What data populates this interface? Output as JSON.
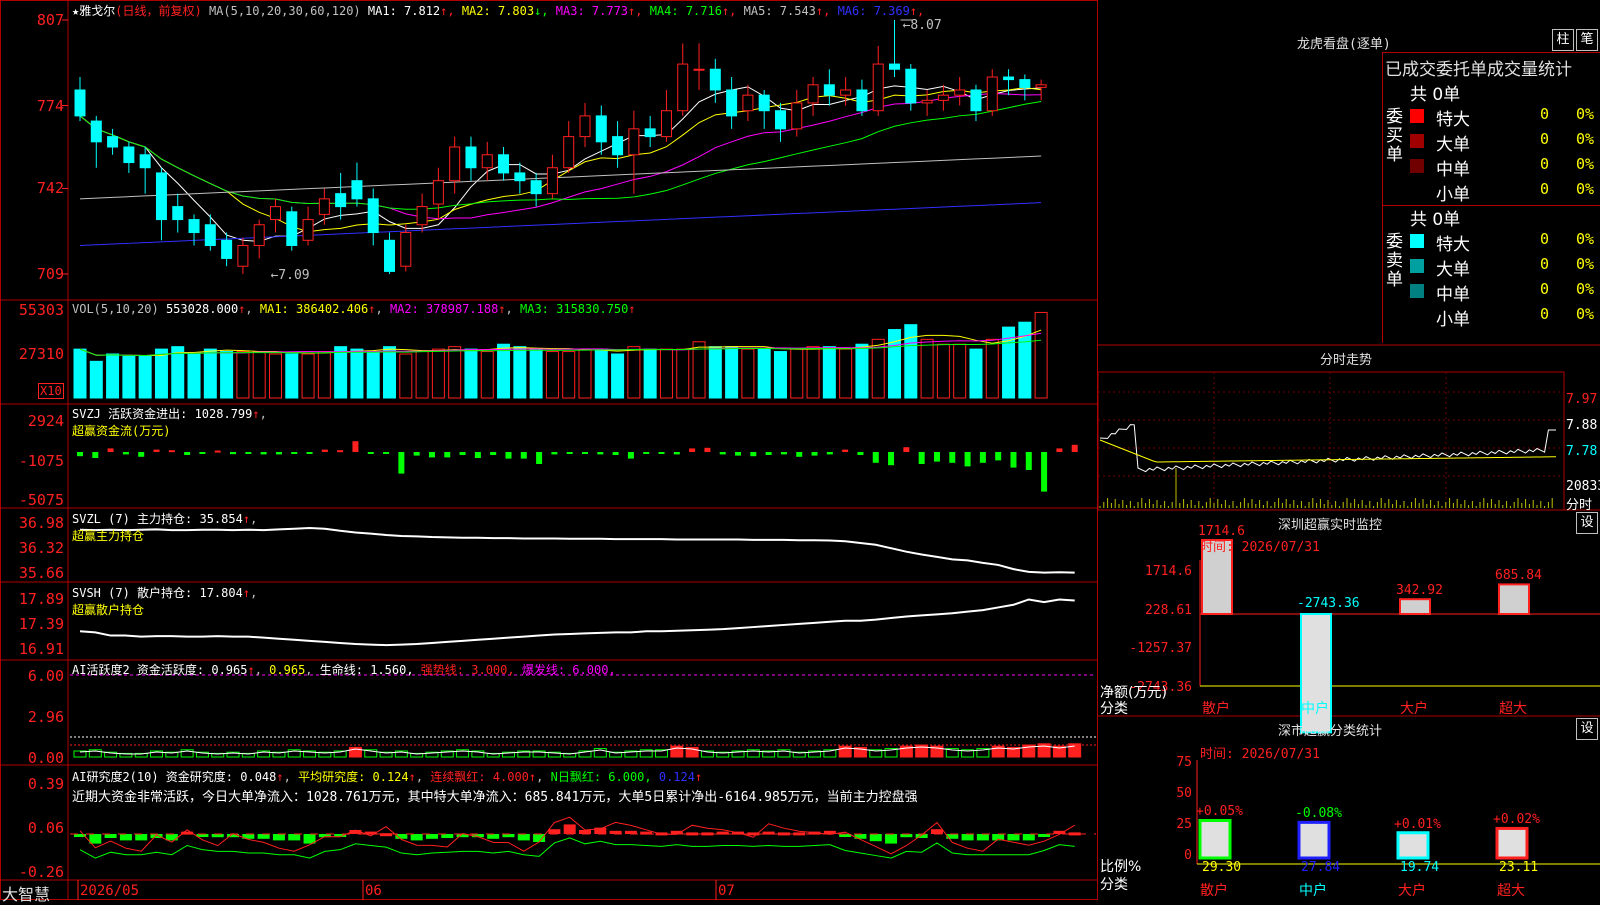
{
  "app": {
    "brand": "大智慧"
  },
  "main": {
    "stock_name": "雅戈尔",
    "period": "(日线，前复权)",
    "ma_label": "MA(5,10,20,30,60,120)",
    "ma_values": [
      {
        "label": "MA1: 7.812",
        "arrow": "↑",
        "color": "#ffffff"
      },
      {
        "label": "MA2: 7.803",
        "arrow": "↓",
        "color": "#ffff00"
      },
      {
        "label": "MA3: 7.773",
        "arrow": "↑",
        "color": "#ff00ff"
      },
      {
        "label": "MA4: 7.716",
        "arrow": "↑",
        "color": "#00ff00"
      },
      {
        "label": "MA5: 7.543",
        "arrow": "↑",
        "color": "#c0c0c0"
      },
      {
        "label": "MA6: 7.369",
        "arrow": "↑",
        "color": "#3030ff"
      }
    ],
    "y_ticks": [
      "807",
      "774",
      "742",
      "709"
    ],
    "high_label": "8.07",
    "low_label": "7.09",
    "dates": [
      "2026/05",
      "06",
      "07"
    ]
  },
  "volume": {
    "label": "VOL(5,10,20)",
    "current": "553028.000",
    "ma1": "MA1: 386402.406",
    "ma2": "MA2: 378987.188",
    "ma3": "MA3: 315830.750",
    "y_ticks": [
      "55303",
      "27310"
    ],
    "unit": "X10"
  },
  "svzj": {
    "label": "SVZJ  活跃资金进出: 1028.799",
    "sub": "超赢资金流(万元)",
    "y_ticks": [
      "2924",
      "-1075",
      "-5075"
    ]
  },
  "svzl": {
    "label": "SVZL (7) 主力持仓: 35.854",
    "sub": "超赢主力持仓",
    "y_ticks": [
      "36.98",
      "36.32",
      "35.66"
    ]
  },
  "svsh": {
    "label": "SVSH (7) 散户持仓: 17.804",
    "sub": "超赢散户持仓",
    "y_ticks": [
      "17.89",
      "17.39",
      "16.91"
    ]
  },
  "ai1": {
    "label": "AI活跃度2 资金活跃度: 0.965",
    "v2": "0.965",
    "life": "生命线: 1.560,",
    "strong": "强势线: 3.000,",
    "burst": "爆发线: 6.000,",
    "y_ticks": [
      "6.00",
      "2.96",
      "0.00"
    ]
  },
  "ai2": {
    "label": "AI研究度2(10) 资金研究度: 0.048",
    "avg": "平均研究度: 0.124",
    "red": "连续飘红: 4.000",
    "nred": "N日飘红: 6.000,",
    "nred2": "0.124",
    "note": "近期大资金非常活跃，今日大单净流入：1028.761万元，其中特大单净流入：685.841万元，大单5日累计净出-6164.985万元，当前主力控盘强",
    "y_ticks": [
      "0.39",
      "0.06",
      "-0.26"
    ]
  },
  "lhb": {
    "title": "龙虎看盘(逐单)",
    "btn1": "柱",
    "btn2": "笔",
    "tabs": "已成交委托单成交量统计",
    "buy_side": "委买单",
    "sell_side": "委卖单",
    "buy_total": "共 0单",
    "sell_total": "共 0单",
    "buy_rows": [
      {
        "name": "特大",
        "val": "0",
        "pct": "0%",
        "color": "#ff0000"
      },
      {
        "name": "大单",
        "val": "0",
        "pct": "0%",
        "color": "#a00000"
      },
      {
        "name": "中单",
        "val": "0",
        "pct": "0%",
        "color": "#700000"
      },
      {
        "name": "小单",
        "val": "0",
        "pct": "0%",
        "color": ""
      }
    ],
    "sell_rows": [
      {
        "name": "特大",
        "val": "0",
        "pct": "0%",
        "color": "#00ffff"
      },
      {
        "name": "大单",
        "val": "0",
        "pct": "0%",
        "color": "#00a0a0"
      },
      {
        "name": "中单",
        "val": "0",
        "pct": "0%",
        "color": "#008080"
      },
      {
        "name": "小单",
        "val": "0",
        "pct": "0%",
        "color": ""
      }
    ]
  },
  "intraday": {
    "title": "分时走势",
    "prices": [
      "7.97",
      "7.88",
      "7.78"
    ],
    "vol": "20833",
    "vol_unit": "分时"
  },
  "sz_monitor": {
    "title": "深圳超赢实时监控",
    "settings": "设",
    "time": "时间: 2026/07/31",
    "y_ticks": [
      "1714.6",
      "228.61",
      "-1257.37",
      "-2743.36"
    ],
    "bars": [
      {
        "cat": "散户",
        "val": 1714.6,
        "label": "1714.6"
      },
      {
        "cat": "中户",
        "val": -2743.36,
        "label": "-2743.36"
      },
      {
        "cat": "大户",
        "val": 342.92,
        "label": "342.92"
      },
      {
        "cat": "超大",
        "val": 685.84,
        "label": "685.84"
      }
    ],
    "ylabel": "净额(万元)",
    "xlabel": "分类"
  },
  "sz_class": {
    "title": "深市超赢分类统计",
    "settings": "设",
    "time": "时间: 2026/07/31",
    "y_ticks": [
      "75",
      "50",
      "25",
      "0"
    ],
    "bars": [
      {
        "cat": "散户",
        "val": 29.3,
        "label": "29.30",
        "chg": "+0.05%",
        "color": "#00ff00"
      },
      {
        "cat": "中户",
        "val": 27.84,
        "label": "27.84",
        "chg": "-0.08%",
        "color": "#2020ff"
      },
      {
        "cat": "大户",
        "val": 19.74,
        "label": "19.74",
        "chg": "+0.01%",
        "color": "#00ffff"
      },
      {
        "cat": "超大",
        "val": 23.11,
        "label": "23.11",
        "chg": "+0.02%",
        "color": "#ff2020"
      }
    ],
    "ylabel": "比例%",
    "xlabel": "分类"
  },
  "chart_data": {
    "type": "candlestick",
    "candles": [
      [
        7.8,
        7.7,
        7.85,
        7.68
      ],
      [
        7.68,
        7.6,
        7.7,
        7.5
      ],
      [
        7.62,
        7.58,
        7.65,
        7.55
      ],
      [
        7.58,
        7.52,
        7.6,
        7.48
      ],
      [
        7.55,
        7.5,
        7.58,
        7.4
      ],
      [
        7.48,
        7.3,
        7.5,
        7.22
      ],
      [
        7.35,
        7.3,
        7.4,
        7.25
      ],
      [
        7.3,
        7.25,
        7.32,
        7.2
      ],
      [
        7.28,
        7.2,
        7.32,
        7.18
      ],
      [
        7.22,
        7.15,
        7.25,
        7.12
      ],
      [
        7.12,
        7.2,
        7.23,
        7.09
      ],
      [
        7.2,
        7.28,
        7.3,
        7.15
      ],
      [
        7.3,
        7.35,
        7.38,
        7.25
      ],
      [
        7.33,
        7.2,
        7.35,
        7.18
      ],
      [
        7.22,
        7.3,
        7.35,
        7.2
      ],
      [
        7.32,
        7.38,
        7.42,
        7.28
      ],
      [
        7.4,
        7.35,
        7.48,
        7.3
      ],
      [
        7.45,
        7.38,
        7.52,
        7.35
      ],
      [
        7.38,
        7.25,
        7.42,
        7.2
      ],
      [
        7.22,
        7.1,
        7.25,
        7.09
      ],
      [
        7.12,
        7.25,
        7.28,
        7.1
      ],
      [
        7.28,
        7.35,
        7.4,
        7.25
      ],
      [
        7.36,
        7.45,
        7.5,
        7.3
      ],
      [
        7.45,
        7.58,
        7.62,
        7.4
      ],
      [
        7.58,
        7.5,
        7.62,
        7.45
      ],
      [
        7.5,
        7.55,
        7.6,
        7.45
      ],
      [
        7.55,
        7.48,
        7.58,
        7.45
      ],
      [
        7.48,
        7.45,
        7.52,
        7.4
      ],
      [
        7.45,
        7.4,
        7.48,
        7.35
      ],
      [
        7.4,
        7.5,
        7.55,
        7.38
      ],
      [
        7.5,
        7.62,
        7.68,
        7.48
      ],
      [
        7.62,
        7.7,
        7.75,
        7.58
      ],
      [
        7.7,
        7.6,
        7.74,
        7.55
      ],
      [
        7.62,
        7.55,
        7.68,
        7.5
      ],
      [
        7.55,
        7.65,
        7.72,
        7.4
      ],
      [
        7.65,
        7.62,
        7.7,
        7.58
      ],
      [
        7.62,
        7.72,
        7.8,
        7.6
      ],
      [
        7.72,
        7.9,
        7.98,
        7.7
      ],
      [
        7.88,
        7.88,
        7.98,
        7.8
      ],
      [
        7.88,
        7.8,
        7.92,
        7.75
      ],
      [
        7.8,
        7.7,
        7.85,
        7.65
      ],
      [
        7.72,
        7.78,
        7.82,
        7.68
      ],
      [
        7.78,
        7.72,
        7.8,
        7.65
      ],
      [
        7.72,
        7.65,
        7.75,
        7.6
      ],
      [
        7.65,
        7.75,
        7.8,
        7.62
      ],
      [
        7.75,
        7.82,
        7.85,
        7.7
      ],
      [
        7.82,
        7.78,
        7.88,
        7.74
      ],
      [
        7.78,
        7.8,
        7.85,
        7.74
      ],
      [
        7.8,
        7.72,
        7.84,
        7.7
      ],
      [
        7.72,
        7.9,
        7.97,
        7.7
      ],
      [
        7.9,
        7.88,
        8.07,
        7.85
      ],
      [
        7.88,
        7.75,
        7.9,
        7.72
      ],
      [
        7.75,
        7.76,
        7.8,
        7.7
      ],
      [
        7.76,
        7.78,
        7.82,
        7.72
      ],
      [
        7.78,
        7.8,
        7.85,
        7.74
      ],
      [
        7.8,
        7.72,
        7.82,
        7.68
      ],
      [
        7.72,
        7.85,
        7.88,
        7.7
      ],
      [
        7.85,
        7.84,
        7.88,
        7.78
      ],
      [
        7.84,
        7.81,
        7.86,
        7.76
      ],
      [
        7.81,
        7.82,
        7.84,
        7.76
      ]
    ],
    "volumes": [
      20,
      15,
      18,
      17,
      17,
      20,
      21,
      18,
      20,
      19,
      19,
      19,
      18,
      18,
      18,
      19,
      21,
      20,
      19,
      21,
      18,
      19,
      20,
      21,
      20,
      19,
      22,
      21,
      20,
      19,
      19,
      20,
      20,
      18,
      21,
      20,
      20,
      20,
      23,
      21,
      21,
      20,
      20,
      19,
      20,
      21,
      21,
      20,
      22,
      24,
      28,
      30,
      24,
      22,
      22,
      20,
      24,
      29,
      31,
      35
    ],
    "svzj": [
      -350,
      -500,
      300,
      -200,
      -400,
      200,
      150,
      -250,
      -150,
      120,
      -180,
      -150,
      -200,
      -200,
      -150,
      -100,
      200,
      150,
      900,
      -100,
      -150,
      -1800,
      -300,
      -450,
      -450,
      -250,
      -500,
      -250,
      -550,
      -550,
      -1000,
      -200,
      -150,
      -150,
      -200,
      -250,
      -550,
      -150,
      -150,
      -200,
      300,
      350,
      -200,
      -300,
      -350,
      -250,
      -200,
      -400,
      -300,
      -200,
      200,
      -250,
      -900,
      -1100,
      400,
      -1000,
      -800,
      -900,
      -1200,
      -900,
      -700,
      -1300,
      -1500,
      -3300,
      300,
      600
    ],
    "svzl": [
      36.93,
      36.92,
      36.93,
      36.92,
      36.93,
      36.94,
      36.92,
      36.92,
      36.93,
      36.93,
      36.92,
      36.93,
      36.92,
      36.94,
      36.96,
      36.98,
      36.96,
      36.9,
      36.85,
      36.82,
      36.78,
      36.75,
      36.74,
      36.72,
      36.71,
      36.7,
      36.7,
      36.69,
      36.69,
      36.68,
      36.68,
      36.68,
      36.67,
      36.67,
      36.67,
      36.66,
      36.66,
      36.66,
      36.66,
      36.65,
      36.65,
      36.65,
      36.65,
      36.65,
      36.64,
      36.64,
      36.64,
      36.63,
      36.63,
      36.62,
      36.6,
      36.55,
      36.5,
      36.4,
      36.3,
      36.22,
      36.15,
      36.08,
      36.05,
      35.98,
      35.92,
      35.8,
      35.72,
      35.7,
      35.71,
      35.7
    ],
    "svsh": [
      17.3,
      17.28,
      17.22,
      17.22,
      17.2,
      17.21,
      17.21,
      17.2,
      17.2,
      17.21,
      17.2,
      17.2,
      17.18,
      17.16,
      17.14,
      17.12,
      17.1,
      17.08,
      17.06,
      17.05,
      17.04,
      17.05,
      17.06,
      17.08,
      17.1,
      17.12,
      17.14,
      17.16,
      17.18,
      17.2,
      17.22,
      17.24,
      17.25,
      17.26,
      17.27,
      17.28,
      17.28,
      17.3,
      17.3,
      17.31,
      17.32,
      17.33,
      17.34,
      17.36,
      17.38,
      17.4,
      17.42,
      17.44,
      17.46,
      17.48,
      17.5,
      17.5,
      17.52,
      17.55,
      17.58,
      17.6,
      17.62,
      17.64,
      17.67,
      17.7,
      17.75,
      17.8,
      17.9,
      17.85,
      17.9,
      17.88
    ],
    "ai1": [
      0.5,
      0.6,
      0.4,
      0.3,
      0.3,
      0.5,
      0.4,
      0.6,
      0.4,
      0.3,
      0.4,
      0.3,
      0.5,
      0.4,
      0.6,
      0.5,
      0.4,
      0.5,
      0.8,
      0.6,
      0.4,
      0.5,
      0.3,
      0.4,
      0.5,
      0.6,
      0.5,
      0.3,
      0.4,
      0.5,
      0.5,
      0.4,
      0.3,
      0.5,
      0.7,
      0.4,
      0.5,
      0.6,
      0.6,
      0.9,
      0.8,
      0.5,
      0.4,
      0.5,
      0.6,
      0.5,
      0.6,
      0.4,
      0.5,
      0.6,
      0.9,
      0.8,
      0.6,
      0.7,
      0.9,
      1.0,
      0.9,
      0.7,
      0.6,
      0.7,
      0.9,
      0.8,
      1.0,
      1.1,
      0.9,
      1.1
    ],
    "ai2": [
      -0.02,
      -0.12,
      -0.05,
      -0.08,
      -0.08,
      -0.05,
      -0.08,
      0.03,
      -0.02,
      -0.04,
      -0.04,
      -0.06,
      -0.06,
      -0.08,
      -0.08,
      -0.12,
      -0.04,
      -0.02,
      0.05,
      0.03,
      0.01,
      -0.06,
      -0.08,
      -0.06,
      -0.05,
      -0.04,
      -0.04,
      -0.06,
      -0.04,
      -0.08,
      -0.1,
      0.06,
      0.12,
      0.05,
      0.08,
      0.04,
      0.04,
      0.03,
      0.02,
      0.04,
      0.02,
      0.02,
      0.03,
      0.03,
      0.02,
      0.03,
      0.02,
      0.02,
      0.03,
      0.04,
      -0.03,
      -0.06,
      -0.09,
      -0.12,
      -0.04,
      -0.05,
      0.06,
      -0.06,
      -0.08,
      -0.08,
      -0.08,
      -0.08,
      -0.08,
      -0.03,
      0.04,
      0.02
    ]
  }
}
